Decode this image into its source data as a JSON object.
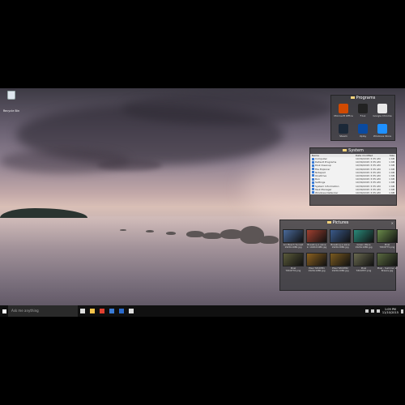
{
  "desktop": {
    "recycle_bin_label": "Recycle Bin"
  },
  "programs": {
    "title": "Programs",
    "items": [
      {
        "label": "Microsoft Office",
        "icon": "office-icon",
        "color": "#d04a02"
      },
      {
        "label": "F.lux",
        "icon": "flux-icon",
        "color": "#222222"
      },
      {
        "label": "Google Chrome",
        "icon": "chrome-icon",
        "color": "#e8e8e8"
      },
      {
        "label": "Steam",
        "icon": "steam-icon",
        "color": "#1b2838"
      },
      {
        "label": "Uplay",
        "icon": "uplay-icon",
        "color": "#0a4aa0"
      },
      {
        "label": "Windows Store",
        "icon": "store-icon",
        "color": "#1e90ff"
      }
    ]
  },
  "system": {
    "title": "System",
    "columns": [
      "Name",
      "Date modified",
      "Size"
    ],
    "rows": [
      {
        "name": "Computer",
        "date": "10/30/2015 3:35 AM",
        "size": "1 KB"
      },
      {
        "name": "Default Programs",
        "date": "10/30/2015 3:35 AM",
        "size": "1 KB"
      },
      {
        "name": "Disk Cleanup",
        "date": "10/30/2015 3:35 AM",
        "size": "1 KB"
      },
      {
        "name": "File Explorer",
        "date": "10/30/2015 3:35 AM",
        "size": "1 KB"
      },
      {
        "name": "Notepad",
        "date": "10/30/2015 3:35 AM",
        "size": "1 KB"
      },
      {
        "name": "OneDrive",
        "date": "10/30/2015 3:35 AM",
        "size": "1 KB"
      },
      {
        "name": "Run",
        "date": "10/30/2015 3:35 AM",
        "size": "1 KB"
      },
      {
        "name": "Settings",
        "date": "10/30/2015 3:35 AM",
        "size": "1 KB"
      },
      {
        "name": "System Information",
        "date": "10/30/2015 3:35 AM",
        "size": "1 KB"
      },
      {
        "name": "Task Manager",
        "date": "10/30/2015 3:35 AM",
        "size": "1 KB"
      },
      {
        "name": "Windows Defender",
        "date": "10/30/2015 3:35 AM",
        "size": "1 KB"
      }
    ]
  },
  "pictures": {
    "title": "Pictures",
    "items": [
      {
        "label": "Arc Beach Sunset 1920x1080.jpg",
        "color": "#4a6a9a"
      },
      {
        "label": "Breaking a wave in 1920x1080.jpg",
        "color": "#a04030"
      },
      {
        "label": "Breaking a wave 1920x1080.jpg",
        "color": "#3a5a8a"
      },
      {
        "label": "Green Wave 1920x1080.jpg",
        "color": "#2a8a7a"
      },
      {
        "label": "Pixel TZCKT75.png",
        "color": "#6a8a4a"
      },
      {
        "label": "Pixel TZCKT76.png",
        "color": "#5a5a3a"
      },
      {
        "label": "Pixel TZCKT81 1920x1080.jpg",
        "color": "#8a6020"
      },
      {
        "label": "Pixel TZCKT82 1920x1080.jpg",
        "color": "#7a5a20"
      },
      {
        "label": "Pixel TZCKT87.png",
        "color": "#6a6a50"
      },
      {
        "label": "Pixel - Summer in Brasov.jpg",
        "color": "#5a6a40"
      }
    ]
  },
  "taskbar": {
    "search_placeholder": "Ask me anything",
    "apps": [
      {
        "icon": "task-view-icon",
        "color": "#dddddd"
      },
      {
        "icon": "file-explorer-icon",
        "color": "#f3c34a"
      },
      {
        "icon": "chrome-icon",
        "color": "#e04030"
      },
      {
        "icon": "store-icon",
        "color": "#3a7bd5"
      },
      {
        "icon": "mail-icon",
        "color": "#2a6acb"
      },
      {
        "icon": "settings-icon",
        "color": "#dddddd"
      }
    ],
    "time": "1:09 PM",
    "date": "11/10/2015"
  }
}
